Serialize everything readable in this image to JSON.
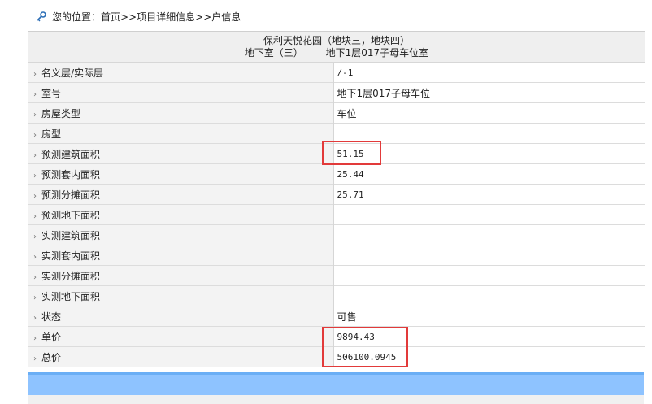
{
  "breadcrumb": {
    "text": "您的位置：首页>>项目详细信息>>户信息"
  },
  "header": {
    "project": "保利天悦花园（地块三，地块四）",
    "building": "地下室（三）",
    "room": "地下1层017子母车位室"
  },
  "rows": [
    {
      "label": "名义层/实际层",
      "value": "/-1"
    },
    {
      "label": "室号",
      "value": "地下1层017子母车位"
    },
    {
      "label": "房屋类型",
      "value": "车位"
    },
    {
      "label": "房型",
      "value": ""
    },
    {
      "label": "预测建筑面积",
      "value": "51.15"
    },
    {
      "label": "预测套内面积",
      "value": "25.44"
    },
    {
      "label": "预测分摊面积",
      "value": "25.71"
    },
    {
      "label": "预测地下面积",
      "value": ""
    },
    {
      "label": "实测建筑面积",
      "value": ""
    },
    {
      "label": "实测套内面积",
      "value": ""
    },
    {
      "label": "实测分摊面积",
      "value": ""
    },
    {
      "label": "实测地下面积",
      "value": ""
    },
    {
      "label": "状态",
      "value": "可售"
    },
    {
      "label": "单价",
      "value": "9894.43"
    },
    {
      "label": "总价",
      "value": "506100.0945"
    }
  ],
  "colors": {
    "highlight": "#e23a3a",
    "bottom_bar": "#8ec3ff"
  },
  "icons": {
    "breadcrumb": "key-icon",
    "row": "chevron-right-icon"
  }
}
